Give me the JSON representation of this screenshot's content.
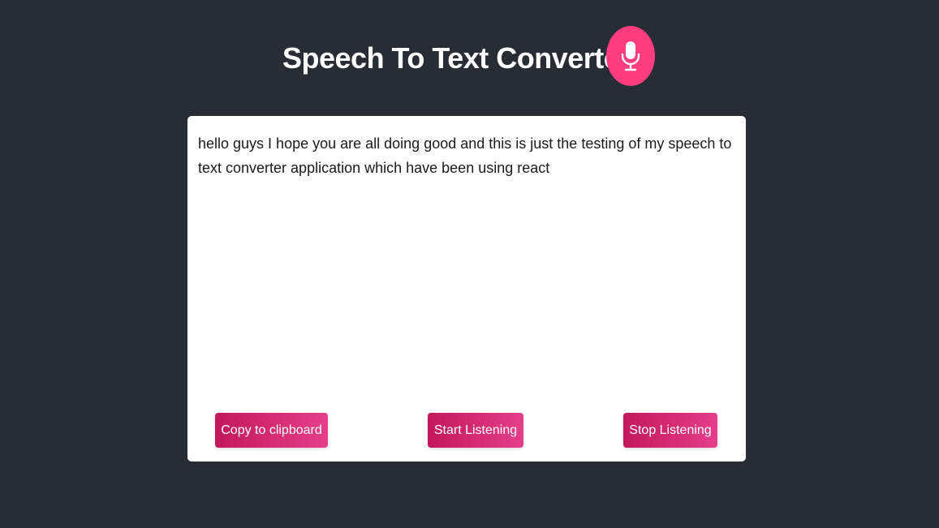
{
  "header": {
    "title": "Speech To Text Converter",
    "icon": "microphone-icon",
    "icon_color": "#ff3d7f"
  },
  "transcript": {
    "text": "hello guys I hope you are all doing good and this is just the testing of my speech to text converter application which have been using react"
  },
  "buttons": {
    "copy_label": "Copy to clipboard",
    "start_label": "Start Listening",
    "stop_label": "Stop Listening"
  },
  "colors": {
    "background": "#282c34",
    "card": "#ffffff",
    "button_gradient_start": "#c2185b",
    "button_gradient_end": "#e63e8a"
  }
}
